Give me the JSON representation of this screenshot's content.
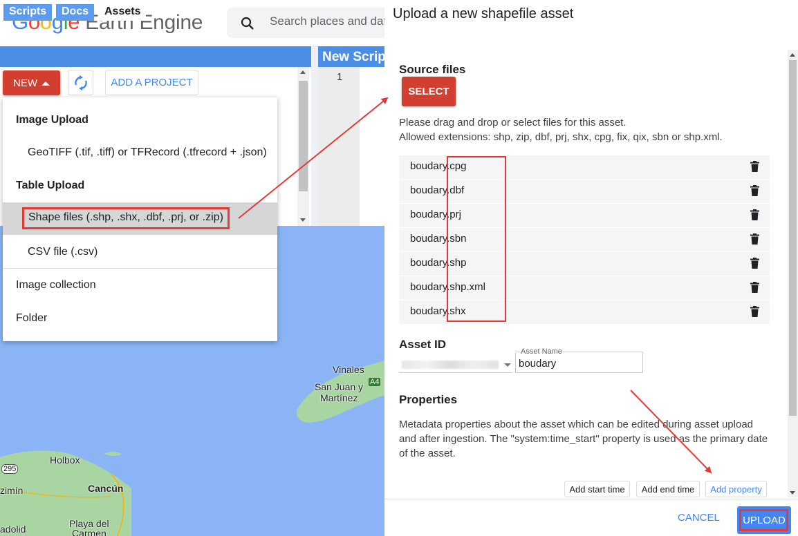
{
  "app": {
    "logo_google": [
      "G",
      "o",
      "o",
      "g",
      "l",
      "e"
    ],
    "logo_rest": "Earth Engine",
    "search_placeholder": "Search places and datasets"
  },
  "left_panel": {
    "tabs": [
      {
        "label": "Scripts",
        "active": false
      },
      {
        "label": "Docs",
        "active": false
      },
      {
        "label": "Assets",
        "active": true
      }
    ],
    "new_label": "NEW",
    "add_project_label": "ADD A PROJECT"
  },
  "editor": {
    "title": "New Script",
    "line_number": "1"
  },
  "new_menu": {
    "image_upload_heading": "Image Upload",
    "image_upload_item": "GeoTIFF (.tif, .tiff) or TFRecord (.tfrecord + .json)",
    "table_upload_heading": "Table Upload",
    "shape_item": "Shape files (.shp, .shx, .dbf, .prj, or .zip)",
    "csv_item": "CSV file (.csv)",
    "image_collection": "Image collection",
    "folder": "Folder"
  },
  "map": {
    "labels": [
      "Vinales",
      "San Juan y",
      "Martínez",
      "A4",
      "Holbox",
      "295",
      "zimín",
      "Cancún",
      "Playa del",
      "Carmen",
      "adolid"
    ]
  },
  "dialog": {
    "title": "Upload a new shapefile asset",
    "source_files_heading": "Source files",
    "select_label": "SELECT",
    "help_line1": "Please drag and drop or select files for this asset.",
    "help_line2": "Allowed extensions: shp, zip, dbf, prj, shx, cpg, fix, qix, sbn or shp.xml.",
    "files": [
      "boudary.cpg",
      "boudary.dbf",
      "boudary.prj",
      "boudary.sbn",
      "boudary.shp",
      "boudary.shp.xml",
      "boudary.shx"
    ],
    "asset_id_heading": "Asset ID",
    "asset_name_label": "Asset Name",
    "asset_name_value": "boudary",
    "properties_heading": "Properties",
    "properties_text": "Metadata properties about the asset which can be edited during asset upload and after ingestion. The \"system:time_start\" property is used as the primary date of the asset.",
    "add_start_time": "Add start time",
    "add_end_time": "Add end time",
    "add_property": "Add property",
    "cancel_label": "CANCEL",
    "upload_label": "UPLOAD"
  },
  "colors": {
    "primary_blue": "#4285f4",
    "panel_blue": "#4a8ee8",
    "red_button": "#d23f31",
    "annotation_red": "#e53935",
    "water": "#8bb4f7",
    "land": "#a8d5a2"
  }
}
